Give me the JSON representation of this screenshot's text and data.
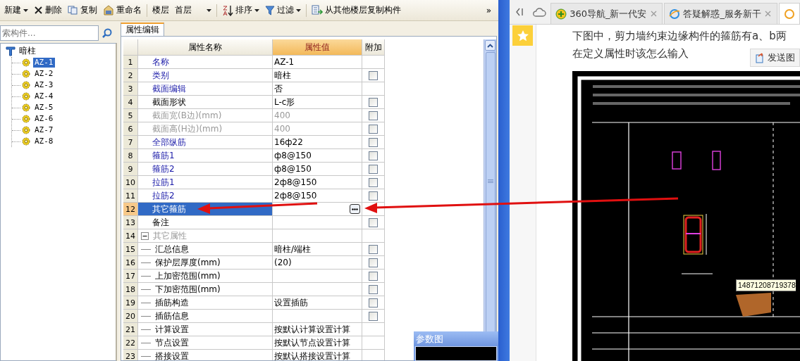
{
  "toolbar": {
    "items": [
      {
        "kind": "menu",
        "label": "新建"
      },
      {
        "kind": "button",
        "label": "删除"
      },
      {
        "kind": "button",
        "label": "复制"
      },
      {
        "kind": "button",
        "label": "重命名"
      },
      {
        "kind": "label",
        "label": "楼层",
        "group_start": true
      },
      {
        "kind": "select",
        "value": "首层"
      },
      {
        "kind": "menu",
        "label": "排序",
        "group_start": true
      },
      {
        "kind": "menu",
        "label": "过滤"
      },
      {
        "kind": "button",
        "label": "从其他楼层复制构件",
        "group_start": true
      }
    ],
    "overflow": "»"
  },
  "search": {
    "placeholder": "索构件..."
  },
  "tree": {
    "label": "暗柱",
    "children": [
      {
        "label": "AZ-1",
        "selected": true
      },
      {
        "label": "AZ-2",
        "selected": false
      },
      {
        "label": "AZ-3",
        "selected": false
      },
      {
        "label": "AZ-4",
        "selected": false
      },
      {
        "label": "AZ-5",
        "selected": false
      },
      {
        "label": "AZ-6",
        "selected": false
      },
      {
        "label": "AZ-7",
        "selected": false
      },
      {
        "label": "AZ-8",
        "selected": false
      }
    ]
  },
  "panel_tab": {
    "label": "属性编辑",
    "selected": true
  },
  "grid": {
    "columns": [
      "属性名称",
      "属性值",
      "附加"
    ],
    "rows": [
      {
        "kind": "plain",
        "number": "1",
        "name": "名称",
        "value": "AZ-1",
        "public": true,
        "disabled": false,
        "selected": false
      },
      {
        "kind": "check",
        "number": "2",
        "name": "类别",
        "value": "暗柱",
        "public": true,
        "disabled": false,
        "selected": false,
        "checked": false
      },
      {
        "kind": "plain",
        "number": "3",
        "name": "截面编辑",
        "value": "否",
        "public": true,
        "disabled": false,
        "selected": false
      },
      {
        "kind": "check",
        "number": "4",
        "name": "截面形状",
        "value": "L-c形",
        "public": false,
        "disabled": false,
        "selected": false,
        "checked": false
      },
      {
        "kind": "check",
        "number": "5",
        "name": "截面宽(B边)(mm)",
        "value": "400",
        "public": false,
        "disabled": true,
        "selected": false,
        "checked": false
      },
      {
        "kind": "check",
        "number": "6",
        "name": "截面高(H边)(mm)",
        "value": "400",
        "public": false,
        "disabled": true,
        "selected": false,
        "checked": false
      },
      {
        "kind": "check",
        "number": "7",
        "name": "全部纵筋",
        "value": "16ф22",
        "public": true,
        "disabled": false,
        "selected": false,
        "checked": false
      },
      {
        "kind": "check",
        "number": "8",
        "name": "箍筋1",
        "value": "ф8@150",
        "public": true,
        "disabled": false,
        "selected": false,
        "checked": false
      },
      {
        "kind": "check",
        "number": "9",
        "name": "箍筋2",
        "value": "ф8@150",
        "public": true,
        "disabled": false,
        "selected": false,
        "checked": false
      },
      {
        "kind": "check",
        "number": "10",
        "name": "拉筋1",
        "value": "2ф8@150",
        "public": true,
        "disabled": false,
        "selected": false,
        "checked": false
      },
      {
        "kind": "check",
        "number": "11",
        "name": "拉筋2",
        "value": "2ф8@150",
        "public": true,
        "disabled": false,
        "selected": false,
        "checked": false
      },
      {
        "kind": "ellipsis",
        "number": "12",
        "name": "其它箍筋",
        "public": true,
        "disabled": false,
        "selected": true
      },
      {
        "kind": "check",
        "number": "13",
        "name": "备注",
        "public": false,
        "disabled": false,
        "selected": false,
        "checked": false
      },
      {
        "kind": "group",
        "number": "14",
        "name": "其它属性",
        "expanded": true,
        "selected": false,
        "children": [
          {
            "kind": "check",
            "number": "15",
            "name": "汇总信息",
            "value": "暗柱/端柱",
            "public": false,
            "disabled": false,
            "selected": false,
            "checked": false
          },
          {
            "kind": "check",
            "number": "16",
            "name": "保护层厚度(mm)",
            "value": "(20)",
            "public": false,
            "disabled": false,
            "selected": false,
            "checked": false
          },
          {
            "kind": "check",
            "number": "17",
            "name": "上加密范围(mm)",
            "public": false,
            "disabled": false,
            "selected": false,
            "checked": false
          },
          {
            "kind": "check",
            "number": "18",
            "name": "下加密范围(mm)",
            "public": false,
            "disabled": false,
            "selected": false,
            "checked": false
          },
          {
            "kind": "check",
            "number": "19",
            "name": "插筋构造",
            "value": "设置插筋",
            "public": false,
            "disabled": false,
            "selected": false,
            "checked": false
          },
          {
            "kind": "check",
            "number": "20",
            "name": "插筋信息",
            "public": false,
            "disabled": false,
            "selected": false,
            "checked": false
          },
          {
            "kind": "plain",
            "number": "21",
            "name": "计算设置",
            "value": "按默认计算设置计算",
            "public": false,
            "disabled": false,
            "selected": false
          },
          {
            "kind": "plain",
            "number": "22",
            "name": "节点设置",
            "value": "按默认节点设置计算",
            "public": false,
            "disabled": false,
            "selected": false
          },
          {
            "kind": "plain",
            "number": "23",
            "name": "搭接设置",
            "value": "按默认搭接设置计算",
            "public": false,
            "disabled": false,
            "selected": false
          }
        ]
      }
    ]
  },
  "param_panel": {
    "title": "参数图"
  },
  "browser": {
    "tabs": [
      {
        "label": "360导航_新一代安",
        "selected": false
      },
      {
        "label": "答疑解惑_服务新干",
        "selected": false
      },
      {
        "selected": true
      }
    ],
    "question_lines": [
      "下图中，剪力墙约束边缘构件的箍筋有a、b两",
      "在定义属性时该怎么输入"
    ],
    "send_button": "发送图",
    "image": {
      "kind": "picture",
      "tooltip": "14871208719378"
    }
  }
}
